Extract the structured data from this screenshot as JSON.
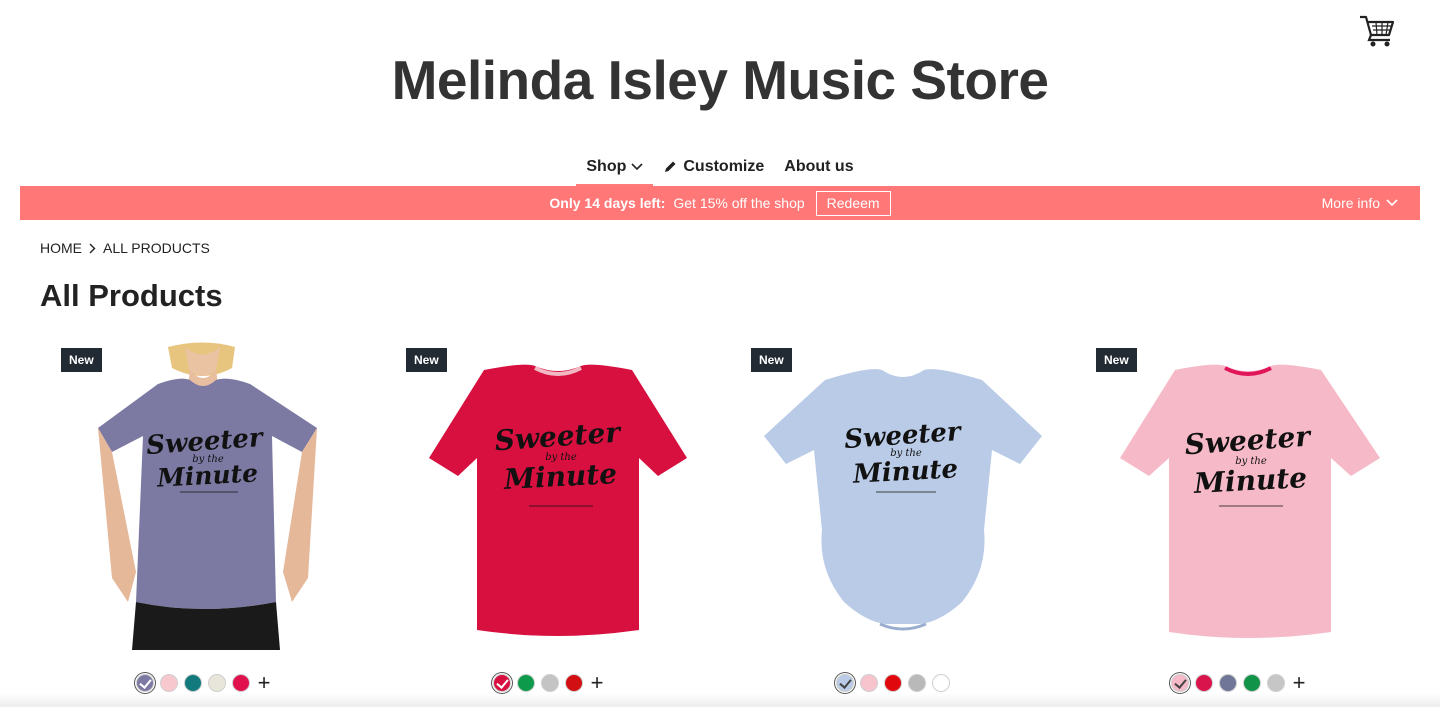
{
  "store": {
    "title": "Melinda Isley Music Store"
  },
  "icons": {
    "cart": "shopping-cart-icon",
    "chevron": "chevron-down-icon",
    "pencil": "pencil-icon",
    "breadcrumb_sep": "chevron-right-icon"
  },
  "nav": {
    "items": [
      {
        "label": "Shop",
        "active": true
      },
      {
        "label": "Customize"
      },
      {
        "label": "About us"
      }
    ]
  },
  "promo": {
    "strong": "Only 14 days left:",
    "offer": "Get 15% off the shop",
    "redeem_label": "Redeem",
    "more_info_label": "More info",
    "bg_color": "#ff7777"
  },
  "breadcrumb": {
    "home": "HOME",
    "current": "ALL PRODUCTS"
  },
  "page": {
    "title": "All Products"
  },
  "products": [
    {
      "badge": "New",
      "shirt_color": "#7c7aa3",
      "swatches": [
        "#7c7aa3",
        "#f7c8cd",
        "#127a7c",
        "#e8e6da",
        "#e0114d"
      ],
      "selected": 0,
      "more": "+"
    },
    {
      "badge": "New",
      "shirt_color": "#d8103f",
      "swatches": [
        "#d8103f",
        "#0d9a4a",
        "#c4c4c4",
        "#d20f12"
      ],
      "selected": 0,
      "more": "+"
    },
    {
      "badge": "New",
      "shirt_color": "#b9cbe7",
      "swatches": [
        "#b9cbe7",
        "#f7c3cc",
        "#e0080c",
        "#b9b9b9",
        "#ffffff"
      ],
      "selected": 0,
      "more": ""
    },
    {
      "badge": "New",
      "shirt_color": "#f6b9c8",
      "swatches": [
        "#f6b9c8",
        "#d9144c",
        "#6f7697",
        "#11934a",
        "#c6c6c6"
      ],
      "selected": 0,
      "more": "+"
    }
  ]
}
